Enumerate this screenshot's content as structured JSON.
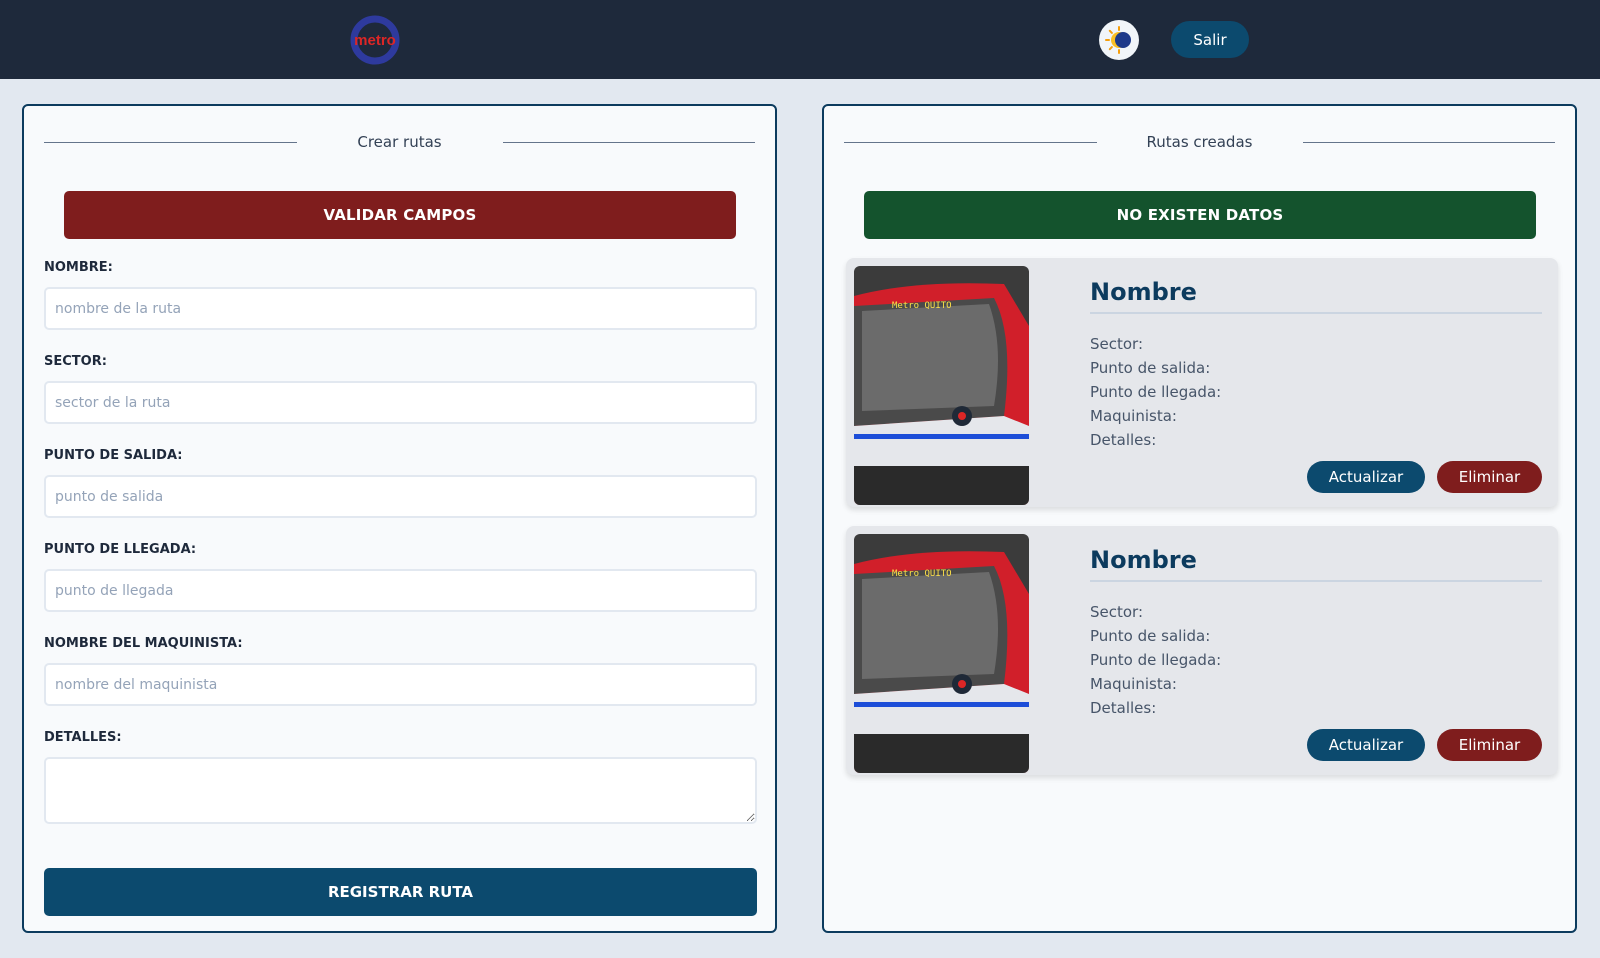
{
  "header": {
    "logo_text": "metro",
    "logout_label": "Salir"
  },
  "create_panel": {
    "legend": "Crear rutas",
    "alert": "VALIDAR CAMPOS",
    "fields": [
      {
        "label": "NOMBRE:",
        "placeholder": "nombre de la ruta"
      },
      {
        "label": "SECTOR:",
        "placeholder": "sector de la ruta"
      },
      {
        "label": "PUNTO DE SALIDA:",
        "placeholder": "punto de salida"
      },
      {
        "label": "PUNTO DE LLEGADA:",
        "placeholder": "punto de llegada"
      },
      {
        "label": "NOMBRE DEL MAQUINISTA:",
        "placeholder": "nombre del maquinista"
      }
    ],
    "details_label": "DETALLES:",
    "submit_label": "REGISTRAR RUTA"
  },
  "routes_panel": {
    "legend": "Rutas creadas",
    "alert": "NO EXISTEN DATOS",
    "cards": [
      {
        "train_sign": "Metro QUITO",
        "title": "Nombre",
        "fields": [
          "Sector:",
          "Punto de salida:",
          "Punto de llegada:",
          "Maquinista:",
          "Detalles:"
        ],
        "update_label": "Actualizar",
        "delete_label": "Eliminar"
      },
      {
        "train_sign": "Metro QUITO",
        "title": "Nombre",
        "fields": [
          "Sector:",
          "Punto de salida:",
          "Punto de llegada:",
          "Maquinista:",
          "Detalles:"
        ],
        "update_label": "Actualizar",
        "delete_label": "Eliminar"
      }
    ]
  },
  "colors": {
    "navbar": "#1e293b",
    "primary": "#0c4a6e",
    "danger": "#7f1d1d",
    "success": "#14532d"
  }
}
